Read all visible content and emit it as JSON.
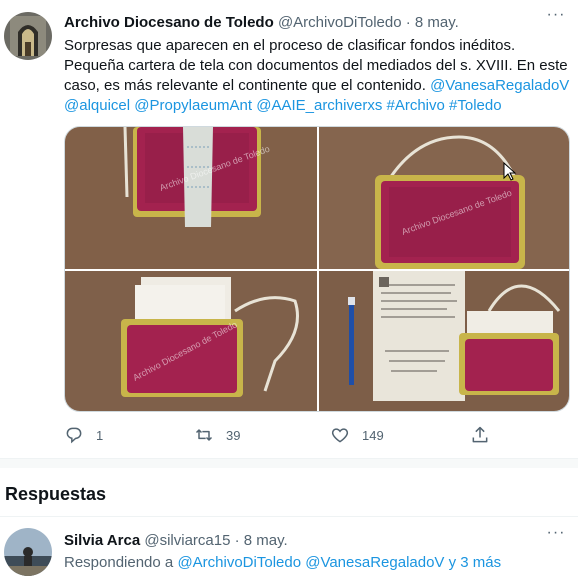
{
  "tweet": {
    "author_name": "Archivo Diocesano de Toledo",
    "handle": "@ArchivoDiToledo",
    "separator": "·",
    "date": "8 may.",
    "more_label": "···",
    "text_plain": "Sorpresas que aparecen en el proceso de clasificar fondos inéditos. Pequeña cartera de tela con documentos del mediados del s. XVIII. En este caso, es más relevante el continente que el contenido.",
    "mentions": [
      "@VanesaRegaladoV",
      "@alquicel",
      "@PropylaeumAnt",
      "@AAIE_archiverxs"
    ],
    "hashtags": [
      "#Archivo",
      "#Toledo"
    ],
    "photo_watermark": "Archivo Diocesano de Toledo",
    "actions": {
      "reply_icon": "reply-icon",
      "reply_count": "1",
      "retweet_icon": "retweet-icon",
      "retweet_count": "39",
      "like_icon": "heart-icon",
      "like_count": "149",
      "share_icon": "share-icon"
    }
  },
  "replies_section": {
    "title": "Respuestas"
  },
  "reply": {
    "author_name": "Silvia Arca",
    "handle": "@silviarca15",
    "separator": "·",
    "date": "8 may.",
    "replying_prefix": "Respondiendo a",
    "replying_handles": "@ArchivoDiToledo @VanesaRegaladoV",
    "replying_suffix": "y 3 más",
    "more_label": "···"
  },
  "colors": {
    "link": "#1b95e0",
    "muted": "#536471",
    "text": "#0f1419",
    "velvet": "#a3224f"
  }
}
